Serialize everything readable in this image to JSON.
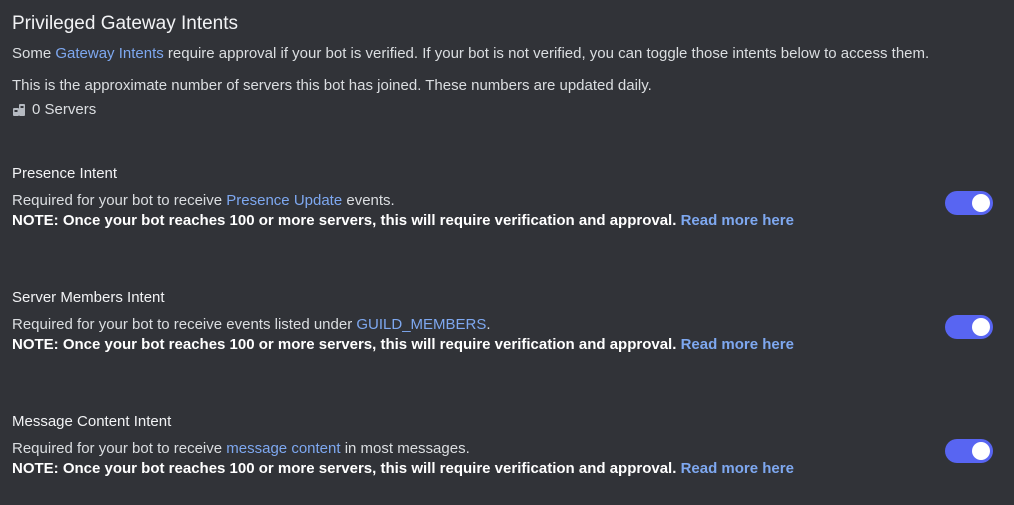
{
  "header": {
    "title": "Privileged Gateway Intents",
    "desc_prefix": "Some ",
    "desc_link": "Gateway Intents",
    "desc_suffix": " require approval if your bot is verified. If your bot is not verified, you can toggle those intents below to access them.",
    "approx_text": "This is the approximate number of servers this bot has joined. These numbers are updated daily.",
    "servers_count": "0 Servers",
    "servers_icon": "servers-icon"
  },
  "intents": [
    {
      "title": "Presence Intent",
      "desc_prefix": "Required for your bot to receive ",
      "desc_link": "Presence Update",
      "desc_suffix": " events.",
      "note": "NOTE: Once your bot reaches 100 or more servers, this will require verification and approval. ",
      "note_link": "Read more here",
      "enabled": true
    },
    {
      "title": "Server Members Intent",
      "desc_prefix": "Required for your bot to receive events listed under ",
      "desc_link": "GUILD_MEMBERS",
      "desc_suffix": ".",
      "note": "NOTE: Once your bot reaches 100 or more servers, this will require verification and approval. ",
      "note_link": "Read more here",
      "enabled": true
    },
    {
      "title": "Message Content Intent",
      "desc_prefix": "Required for your bot to receive ",
      "desc_link": "message content",
      "desc_suffix": " in most messages.",
      "note": "NOTE: Once your bot reaches 100 or more servers, this will require verification and approval. ",
      "note_link": "Read more here",
      "enabled": true
    }
  ],
  "colors": {
    "background": "#313338",
    "link": "#7ea8f0",
    "toggle_on": "#5865f2"
  }
}
